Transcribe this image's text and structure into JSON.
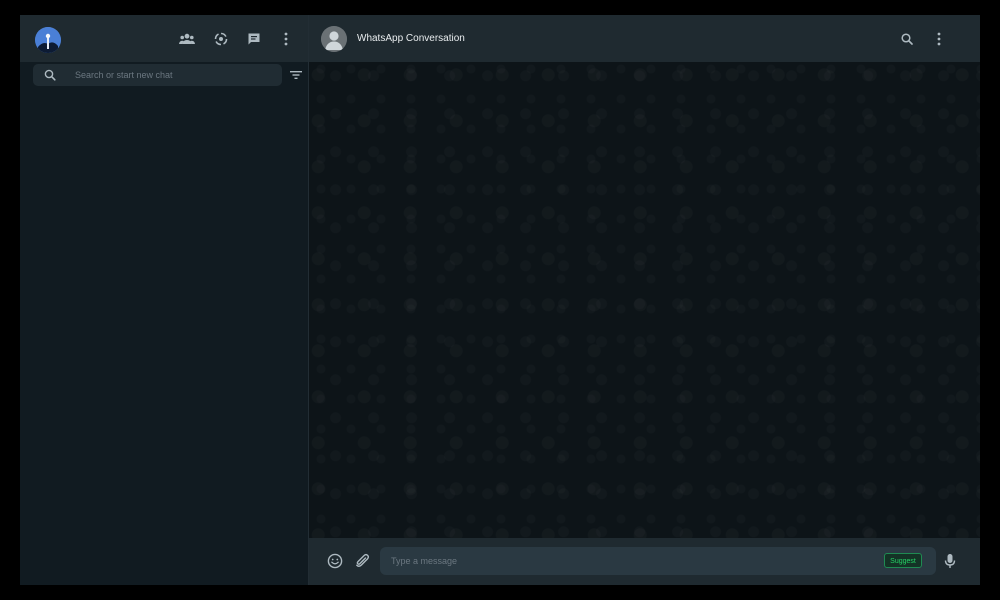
{
  "sidebar": {
    "header": {
      "profile_avatar_icon": "avatar-icon",
      "icons": [
        "communities-icon",
        "status-icon",
        "new-chat-icon",
        "menu-icon"
      ]
    },
    "search": {
      "placeholder": "Search or start new chat",
      "value": "",
      "icon": "search-icon",
      "filter_icon": "filter-icon"
    }
  },
  "conversation": {
    "title": "WhatsApp Conversation",
    "avatar_icon": "default-contact-avatar-icon",
    "header_icons": [
      "search-icon",
      "menu-icon"
    ]
  },
  "composer": {
    "placeholder": "Type a message",
    "value": "",
    "suggest_label": "Suggest",
    "icons": [
      "emoji-icon",
      "attach-icon",
      "microphone-icon"
    ]
  },
  "colors": {
    "panel_header": "#1f2a30",
    "sidebar_bg": "#111b21",
    "chat_bg": "#0d1418",
    "input_bg": "#2a3942",
    "icon": "#aebac1",
    "accent_green": "#25d366",
    "text_primary": "#e9edef"
  }
}
